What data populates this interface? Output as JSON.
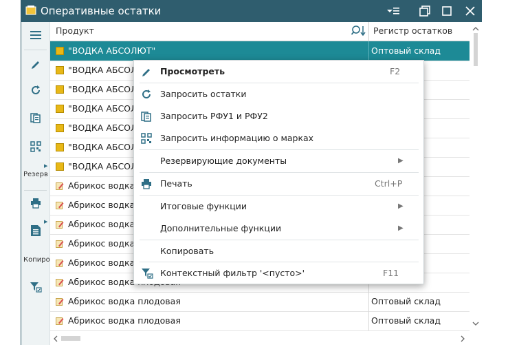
{
  "window": {
    "title": "Оперативные остатки"
  },
  "toolbar": {
    "reserve_label": "Резерв",
    "copy_label": "Копиро"
  },
  "grid": {
    "col_product": "Продукт",
    "col_register": "Регистр остатков",
    "rows": [
      {
        "product": "\"ВОДКА АБСОЛЮТ\"",
        "register": "Оптовый склад",
        "selected": true
      },
      {
        "product": "\"ВОДКА АБСОЛЮТ\"",
        "register": ""
      },
      {
        "product": "\"ВОДКА АБСОЛЮТ\"",
        "register": ""
      },
      {
        "product": "\"ВОДКА АБСОЛЮТ\"",
        "register": ""
      },
      {
        "product": "\"ВОДКА АБСОЛЮТ\"",
        "register": ""
      },
      {
        "product": "\"ВОДКА АБСОЛЮТ\"",
        "register": ""
      },
      {
        "product": "\"ВОДКА АБСОЛЮТ\"",
        "register": ""
      },
      {
        "product": "Абрикос водка плодовая",
        "register": ""
      },
      {
        "product": "Абрикос водка плодовая",
        "register": ""
      },
      {
        "product": "Абрикос водка плодовая",
        "register": ""
      },
      {
        "product": "Абрикос водка плодовая",
        "register": ""
      },
      {
        "product": "Абрикос водка плодовая",
        "register": ""
      },
      {
        "product": "Абрикос водка плодовая",
        "register": ""
      },
      {
        "product": "Абрикос водка плодовая",
        "register": "Оптовый склад"
      },
      {
        "product": "Абрикос водка плодовая",
        "register": "Оптовый склад"
      }
    ]
  },
  "context_menu": {
    "view": {
      "label": "Просмотреть",
      "shortcut": "F2"
    },
    "request_stock": {
      "label": "Запросить остатки"
    },
    "request_rfu": {
      "label": "Запросить РФУ1 и РФУ2"
    },
    "request_marks": {
      "label": "Запросить информацию о марках"
    },
    "reserve_docs": {
      "label": "Резервирующие документы"
    },
    "print": {
      "label": "Печать",
      "shortcut": "Ctrl+P"
    },
    "totals": {
      "label": "Итоговые функции"
    },
    "extra": {
      "label": "Дополнительные функции"
    },
    "copy": {
      "label": "Копировать"
    },
    "context_filter": {
      "label": "Контекстный фильтр '<пусто>'",
      "shortcut": "F11"
    }
  },
  "colors": {
    "titlebar": "#2f5d6e",
    "selection": "#1d8a96",
    "accent": "#2f6f86",
    "folder_icon": "#e8b817"
  }
}
